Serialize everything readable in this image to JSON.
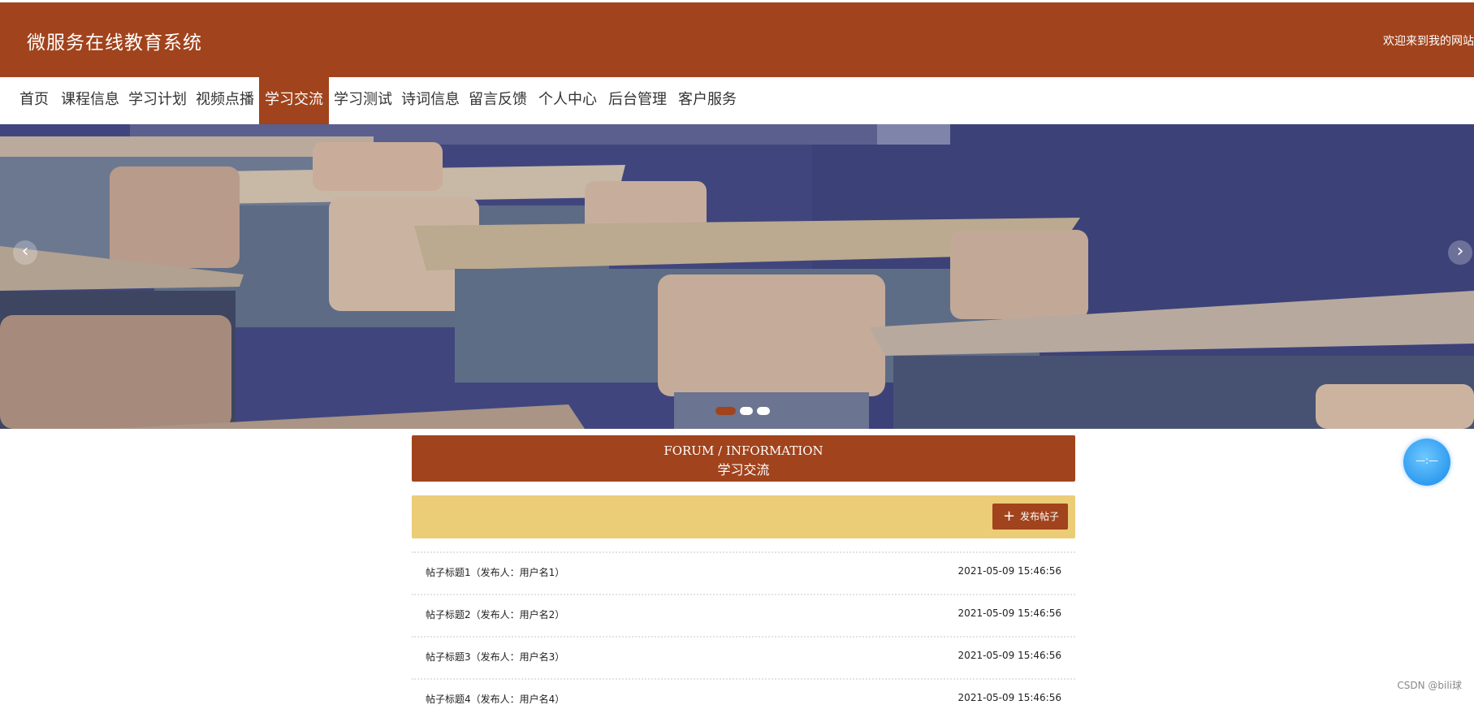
{
  "header": {
    "site_title": "微服务在线教育系统",
    "welcome_text": "欢迎来到我的网站"
  },
  "nav": {
    "items": [
      {
        "label": "首页"
      },
      {
        "label": "课程信息"
      },
      {
        "label": "学习计划"
      },
      {
        "label": "视频点播"
      },
      {
        "label": "学习交流",
        "active": true
      },
      {
        "label": "学习测试"
      },
      {
        "label": "诗词信息"
      },
      {
        "label": "留言反馈"
      },
      {
        "label": "个人中心"
      },
      {
        "label": "后台管理"
      },
      {
        "label": "客户服务"
      }
    ]
  },
  "banner": {
    "prev_icon": "chevron-left-icon",
    "next_icon": "chevron-right-icon",
    "prev_symbol": "‹",
    "next_symbol": "›",
    "active_index": 0,
    "slide_count": 3
  },
  "forum": {
    "title_en": "FORUM / INFORMATION",
    "title_cn": "学习交流",
    "post_button_label": "发布帖子",
    "post_button_icon": "plus-icon",
    "plus_symbol": "+",
    "posts": [
      {
        "title": "帖子标题1（发布人：用户名1）",
        "date": "2021-05-09 15:46:56"
      },
      {
        "title": "帖子标题2（发布人：用户名2）",
        "date": "2021-05-09 15:46:56"
      },
      {
        "title": "帖子标题3（发布人：用户名3）",
        "date": "2021-05-09 15:46:56"
      },
      {
        "title": "帖子标题4（发布人：用户名4）",
        "date": "2021-05-09 15:46:56"
      }
    ]
  },
  "float_widget": {
    "icon": "chat-bubble-icon",
    "label": "—:—"
  },
  "watermark": "CSDN @bili球",
  "colors": {
    "brand": "#a1431c",
    "toolbar": "#ebcc77"
  }
}
